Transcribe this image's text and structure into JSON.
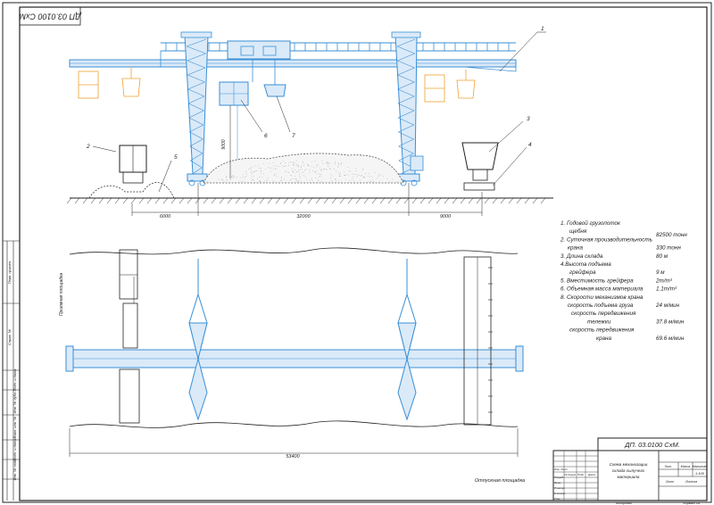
{
  "stamp_rotated": "ДП 03.0100 СхМ",
  "callouts": [
    "1",
    "2",
    "3",
    "4",
    "5",
    "6",
    "7"
  ],
  "dimensions": {
    "height": "9000",
    "left": "6000",
    "middle": "32000",
    "right": "9000",
    "length": "53400"
  },
  "labels": {
    "receiving_area": "Приемная площадка",
    "shipping_area": "Отпускная площадка"
  },
  "specs": [
    {
      "text": "1. Годовой грузопоток",
      "value": ""
    },
    {
      "text": "щебня",
      "value": "82500 тонн"
    },
    {
      "text": "2. Суточная производительность",
      "value": ""
    },
    {
      "text": "крана",
      "value": "330 тонн"
    },
    {
      "text": "3. Длина склада",
      "value": "80 м"
    },
    {
      "text": "4.Высота подъема",
      "value": ""
    },
    {
      "text": "грейфера",
      "value": "9 м"
    },
    {
      "text": "5. Вместимость грейфера",
      "value": "2m/m³"
    },
    {
      "text": "6. Объемная масса материала",
      "value": "1.1m/m³"
    },
    {
      "text": "8. Скорости механизмов крана",
      "value": ""
    },
    {
      "text": "скорость подъема груза",
      "value": "24 м/мин"
    },
    {
      "text": "скорость передвижения",
      "value": ""
    },
    {
      "text": "тележки",
      "value": "37.8 м/мин"
    },
    {
      "text": "скорость передвижения",
      "value": ""
    },
    {
      "text": "крана",
      "value": "69.6 м/мин"
    }
  ],
  "title_block": {
    "designation": "ДП. 03.0100 СхМ.",
    "title_line1": "Схема механизации",
    "title_line2": "склада сыпучего",
    "title_line3": "материала",
    "col_lit": "Лит.",
    "col_mass": "Масса",
    "col_scale": "Масштаб",
    "scale": "1:100",
    "sheet": "Лист",
    "sheets": "Листов",
    "roles": [
      "Изм. Лист",
      "Разраб.",
      "Пров.",
      "Т.контр.",
      "Н.контр.",
      "Утв."
    ],
    "head_cols": [
      "№ докум.",
      "Подп.",
      "Дата"
    ],
    "copied": "Копировал",
    "format": "Формат   А1"
  },
  "side_strip": [
    "Перв. примен.",
    "Справ. №",
    "Подп. и дата",
    "Инв. № дубл.",
    "Взам. инв. №",
    "Подп. и дата",
    "Инв. № подл."
  ]
}
